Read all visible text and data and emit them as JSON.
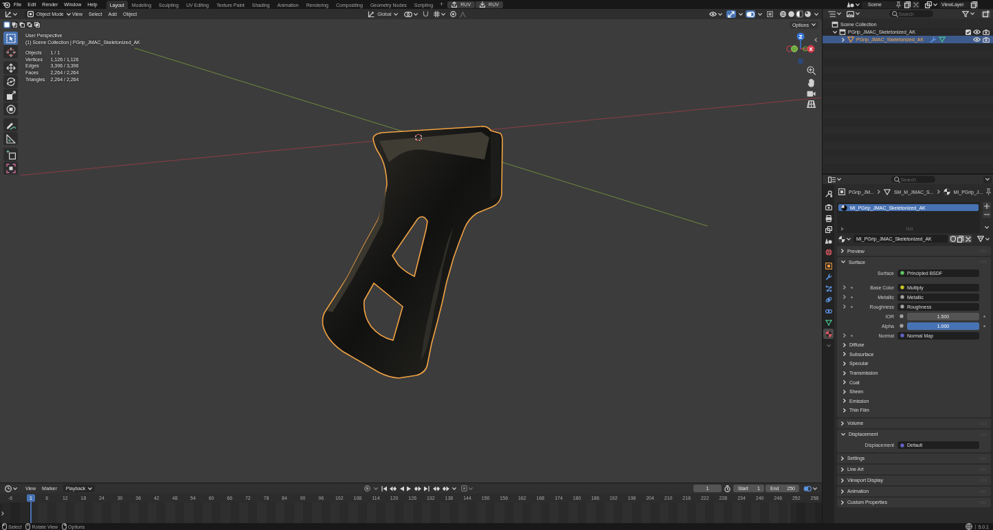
{
  "top_bar": {
    "menus": [
      "File",
      "Edit",
      "Render",
      "Window",
      "Help"
    ],
    "workspaces": [
      {
        "label": "Layout",
        "selected": true
      },
      {
        "label": "Modeling",
        "selected": false
      },
      {
        "label": "Sculpting",
        "selected": false
      },
      {
        "label": "UV Editing",
        "selected": false
      },
      {
        "label": "Texture Paint",
        "selected": false
      },
      {
        "label": "Shading",
        "selected": false
      },
      {
        "label": "Animation",
        "selected": false
      },
      {
        "label": "Rendering",
        "selected": false
      },
      {
        "label": "Compositing",
        "selected": false
      },
      {
        "label": "Geometry Nodes",
        "selected": false
      },
      {
        "label": "Scripting",
        "selected": false
      }
    ],
    "add_label": "+",
    "addon_buttons": [
      {
        "kind": "upload",
        "label": "RUV"
      },
      {
        "kind": "download",
        "label": "RUV"
      }
    ],
    "scene": "Scene",
    "view_layer": "ViewLayer"
  },
  "viewport": {
    "mode": "Object Mode",
    "menus": [
      "View",
      "Select",
      "Add",
      "Object"
    ],
    "orientation": "Global",
    "toggles": [
      {
        "kind": "gizmos",
        "on": true
      },
      {
        "kind": "overlays",
        "on": true
      },
      {
        "kind": "xray",
        "on": false
      }
    ],
    "shading": [
      {
        "kind": "wireframe",
        "selected": false
      },
      {
        "kind": "solid",
        "selected": false
      },
      {
        "kind": "material",
        "selected": true
      },
      {
        "kind": "rendered",
        "selected": false
      }
    ],
    "select_modes": [
      {
        "kind": "set",
        "selected": true
      },
      {
        "kind": "extend",
        "selected": false
      },
      {
        "kind": "subtract",
        "selected": false
      },
      {
        "kind": "invert",
        "selected": false
      },
      {
        "kind": "intersect",
        "selected": false
      }
    ],
    "options": "Options",
    "tools": [
      {
        "kind": "select_box",
        "selected": true
      },
      {
        "kind": "cursor",
        "selected": false
      },
      {
        "kind": "move",
        "selected": false
      },
      {
        "kind": "rotate",
        "selected": false
      },
      {
        "kind": "scale",
        "selected": false
      },
      {
        "kind": "transform",
        "selected": false
      },
      {
        "kind": "annotate",
        "selected": false
      },
      {
        "kind": "measure",
        "selected": false
      },
      {
        "kind": "add_cube",
        "selected": false
      },
      {
        "kind": "uv",
        "selected": false
      }
    ],
    "info": {
      "view": "User Perspective",
      "collection": "(1) Scene Collection | PGrip_JMAC_Skeletonized_AK",
      "stats": [
        {
          "label": "Objects",
          "value": "1 / 1"
        },
        {
          "label": "Vertices",
          "value": "1,126 / 1,126"
        },
        {
          "label": "Edges",
          "value": "3,396 / 3,396"
        },
        {
          "label": "Faces",
          "value": "2,264 / 2,264"
        },
        {
          "label": "Triangles",
          "value": "2,264 / 2,264"
        }
      ]
    },
    "gizmo": {
      "up": "Z",
      "right": "X"
    }
  },
  "outliner": {
    "search_placeholder": "Search",
    "tree": [
      {
        "kind": "scene_collection",
        "label": "Scene Collection",
        "selected": false,
        "children": [
          {
            "kind": "collection",
            "label": "PGrip_JMAC_Skeletonized_AK",
            "expanded": true,
            "checked": true,
            "selected": false,
            "children": [
              {
                "kind": "object",
                "label": "PGrip_JMAC_Skeletonized_AK",
                "expanded": false,
                "selected": true
              }
            ]
          }
        ]
      }
    ]
  },
  "properties": {
    "search_placeholder": "Search",
    "tabs": [
      {
        "kind": "tool",
        "selected": false
      },
      {
        "kind": "render",
        "selected": false
      },
      {
        "kind": "output",
        "selected": false
      },
      {
        "kind": "view_layer",
        "selected": false
      },
      {
        "kind": "scene",
        "selected": false
      },
      {
        "kind": "world",
        "selected": false
      },
      {
        "kind": "object",
        "selected": false
      },
      {
        "kind": "modifiers",
        "selected": false
      },
      {
        "kind": "particles",
        "selected": false
      },
      {
        "kind": "physics",
        "selected": false
      },
      {
        "kind": "constraints",
        "selected": false
      },
      {
        "kind": "data",
        "selected": false
      },
      {
        "kind": "material",
        "selected": true
      }
    ],
    "breadcrumbs": [
      {
        "kind": "object",
        "label": "PGrip_JM..."
      },
      {
        "kind": "mesh",
        "label": "SM_M_JMAC_S..."
      },
      {
        "kind": "material",
        "label": "MI_PGrip_J..."
      }
    ],
    "slots": [
      {
        "label": "MI_PGrip_JMAC_Skeletonized_AK",
        "selected": true
      }
    ],
    "material": "MI_PGrip_JMAC_Skeletonized_AK",
    "panels": [
      {
        "label": "Preview",
        "expanded": false
      },
      {
        "label": "Surface",
        "expanded": true,
        "rows": [
          {
            "kind": "socket",
            "label": "Surface",
            "value": "Principled BSDF",
            "color": "#63c763"
          },
          {
            "kind": "socket",
            "label": "Base Color",
            "value": "Multiply",
            "color": "#c7c729",
            "expanded": false
          },
          {
            "kind": "socket",
            "label": "Metallic",
            "value": "Metallic",
            "color": "#a1a1a1",
            "expanded": false
          },
          {
            "kind": "socket",
            "label": "Roughness",
            "value": "Roughness",
            "color": "#a1a1a1",
            "expanded": false
          },
          {
            "kind": "number",
            "label": "IOR",
            "value": "1.500",
            "color": "#a1a1a1"
          },
          {
            "kind": "slider",
            "label": "Alpha",
            "value": "1.000",
            "level": 1,
            "color": "#a1a1a1"
          },
          {
            "kind": "socket",
            "label": "Normal",
            "value": "Normal Map",
            "color": "#6363c7",
            "expanded": false
          }
        ],
        "subpanels": [
          {
            "label": "Diffuse",
            "expanded": false
          },
          {
            "label": "Subsurface",
            "expanded": false
          },
          {
            "label": "Specular",
            "expanded": false
          },
          {
            "label": "Transmission",
            "expanded": false
          },
          {
            "label": "Coat",
            "expanded": false
          },
          {
            "label": "Sheen",
            "expanded": false
          },
          {
            "label": "Emission",
            "expanded": false
          },
          {
            "label": "Thin Film",
            "expanded": false
          }
        ]
      },
      {
        "label": "Volume",
        "expanded": false
      },
      {
        "label": "Displacement",
        "expanded": true,
        "rows": [
          {
            "kind": "socket",
            "label": "Displacement",
            "value": "Default",
            "color": "#6363c7"
          }
        ]
      },
      {
        "label": "Settings",
        "expanded": false
      },
      {
        "label": "Line Art",
        "expanded": false
      },
      {
        "label": "Viewport Display",
        "expanded": false
      },
      {
        "label": "Animation",
        "expanded": false
      },
      {
        "label": "Custom Properties",
        "expanded": false
      }
    ]
  },
  "timeline": {
    "menus": [
      "View",
      "Marker"
    ],
    "playback": "Playback",
    "frame": "1",
    "start_label": "Start",
    "start": "1",
    "end_label": "End",
    "end": "250",
    "ruler": [
      "-6",
      "6",
      "12",
      "18",
      "24",
      "30",
      "36",
      "42",
      "48",
      "54",
      "60",
      "66",
      "72",
      "78",
      "84",
      "90",
      "96",
      "102",
      "108",
      "114",
      "120",
      "126",
      "132",
      "138",
      "144",
      "150",
      "156",
      "162",
      "168",
      "174",
      "180",
      "186",
      "192",
      "198",
      "204",
      "210",
      "216",
      "222",
      "228",
      "234",
      "240",
      "246",
      "252",
      "258"
    ],
    "playhead": "1"
  },
  "status_bar": {
    "hints": [
      {
        "kind": "left",
        "label": "Select"
      },
      {
        "kind": "middle",
        "label": "Rotate View"
      },
      {
        "kind": "right",
        "label": "Options"
      }
    ],
    "version": "5.0.1"
  }
}
